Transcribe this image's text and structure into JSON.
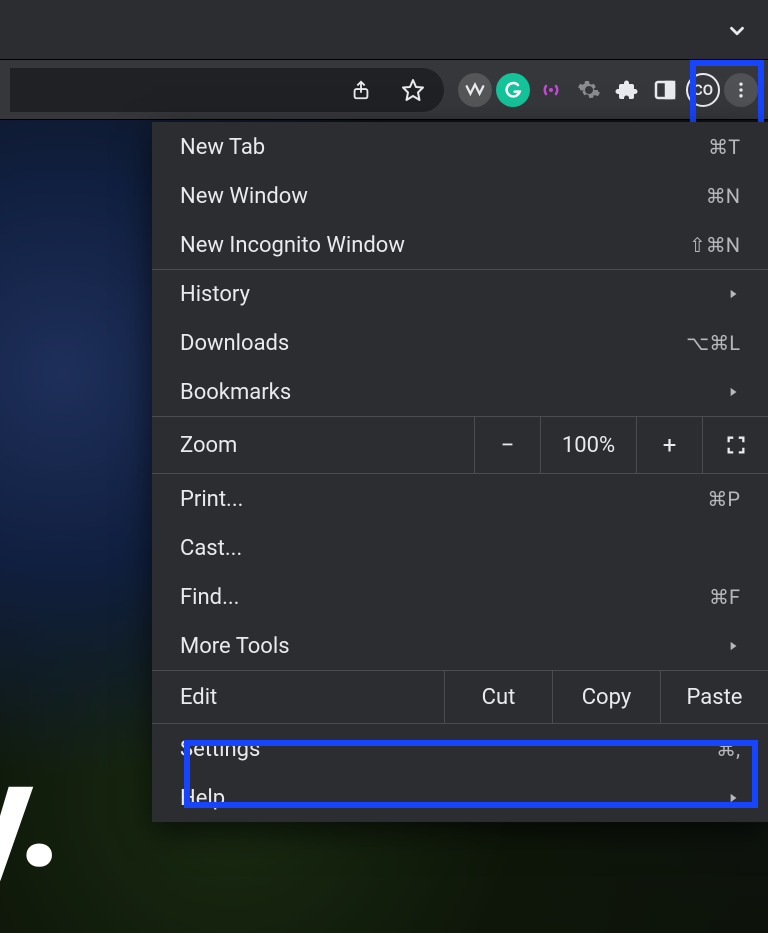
{
  "page": {
    "partial_text": "ey."
  },
  "toolbar": {
    "profile_initials": "CO"
  },
  "menu": {
    "new_tab": {
      "label": "New Tab",
      "shortcut": "⌘T"
    },
    "new_window": {
      "label": "New Window",
      "shortcut": "⌘N"
    },
    "new_incognito": {
      "label": "New Incognito Window",
      "shortcut": "⇧⌘N"
    },
    "history": {
      "label": "History"
    },
    "downloads": {
      "label": "Downloads",
      "shortcut": "⌥⌘L"
    },
    "bookmarks": {
      "label": "Bookmarks"
    },
    "zoom": {
      "label": "Zoom",
      "value": "100%",
      "minus": "−",
      "plus": "+"
    },
    "print": {
      "label": "Print...",
      "shortcut": "⌘P"
    },
    "cast": {
      "label": "Cast..."
    },
    "find": {
      "label": "Find...",
      "shortcut": "⌘F"
    },
    "more_tools": {
      "label": "More Tools"
    },
    "edit": {
      "label": "Edit",
      "cut": "Cut",
      "copy": "Copy",
      "paste": "Paste"
    },
    "settings": {
      "label": "Settings",
      "shortcut": "⌘,"
    },
    "help": {
      "label": "Help"
    }
  }
}
